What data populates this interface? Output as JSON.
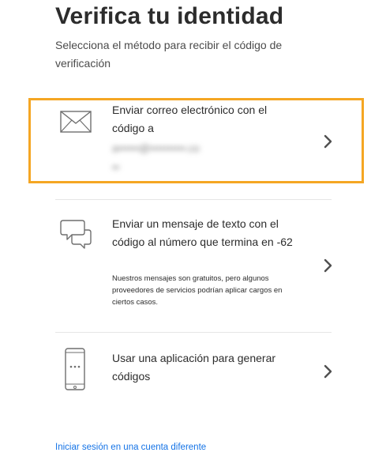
{
  "header": {
    "title": "Verifica tu identidad",
    "subtitle": "Selecciona el método para recibir el código de verificación"
  },
  "options": [
    {
      "icon": "envelope-icon",
      "label": "Enviar correo electrónico con el código a",
      "masked_value": "a••••••@••••••••••.co",
      "highlighted": true
    },
    {
      "icon": "chat-bubbles-icon",
      "label": "Enviar un mensaje de texto con el código al número que termina en -62",
      "note": "Nuestros mensajes son gratuitos, pero algunos proveedores de servicios podrían aplicar cargos en ciertos casos."
    },
    {
      "icon": "phone-app-icon",
      "label": "Usar una aplicación para generar códigos"
    }
  ],
  "footer": {
    "link_label": "Iniciar sesión en una cuenta diferente"
  },
  "colors": {
    "highlight": "#f5a623",
    "link": "#1473e6",
    "text": "#2c2c2c"
  }
}
